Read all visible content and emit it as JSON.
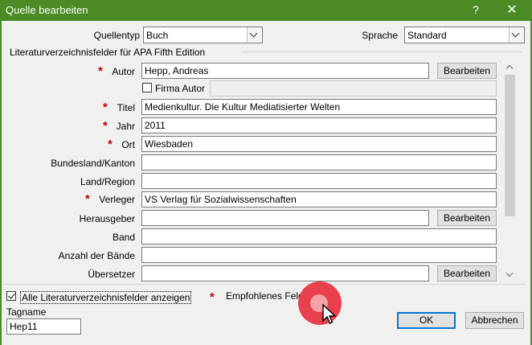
{
  "window": {
    "title": "Quelle bearbeiten",
    "help_label": "?",
    "close_label": "✕"
  },
  "source_type": {
    "label": "Quellentyp",
    "value": "Buch"
  },
  "language": {
    "label": "Sprache",
    "value": "Standard"
  },
  "group_label": "Literaturverzeichnisfelder für APA Fifth Edition",
  "fields": {
    "autor": {
      "label": "Autor",
      "value": "Hepp, Andreas",
      "button": "Bearbeiten"
    },
    "firma_autor": {
      "label": "Firma Autor",
      "value": ""
    },
    "titel": {
      "label": "Titel",
      "value": "Medienkultur. Die Kultur Mediatisierter Welten"
    },
    "jahr": {
      "label": "Jahr",
      "value": "2011"
    },
    "ort": {
      "label": "Ort",
      "value": "Wiesbaden"
    },
    "bundesland": {
      "label": "Bundesland/Kanton",
      "value": ""
    },
    "land": {
      "label": "Land/Region",
      "value": ""
    },
    "verleger": {
      "label": "Verleger",
      "value": "VS Verlag für Sozialwissenschaften"
    },
    "herausgeber": {
      "label": "Herausgeber",
      "value": "",
      "button": "Bearbeiten"
    },
    "band": {
      "label": "Band",
      "value": ""
    },
    "anzahl_baende": {
      "label": "Anzahl der Bände",
      "value": ""
    },
    "uebersetzer": {
      "label": "Übersetzer",
      "value": "",
      "button": "Bearbeiten"
    }
  },
  "required_marker": "*",
  "show_all": {
    "label": "Alle Literaturverzeichnisfelder anzeigen",
    "checked": true
  },
  "recommended_legend": "Empfohlenes Feld",
  "tag": {
    "label": "Tagname",
    "value": "Hep11"
  },
  "buttons": {
    "ok": "OK",
    "cancel": "Abbrechen"
  },
  "colors": {
    "titlebar": "#4a8b25",
    "required": "#c00000",
    "cursor_highlight": "#e8404c"
  },
  "icons": [
    "help-icon",
    "close-icon",
    "chevron-down-icon",
    "scroll-up-icon",
    "scroll-down-icon",
    "checkmark-icon",
    "mouse-pointer-icon"
  ]
}
